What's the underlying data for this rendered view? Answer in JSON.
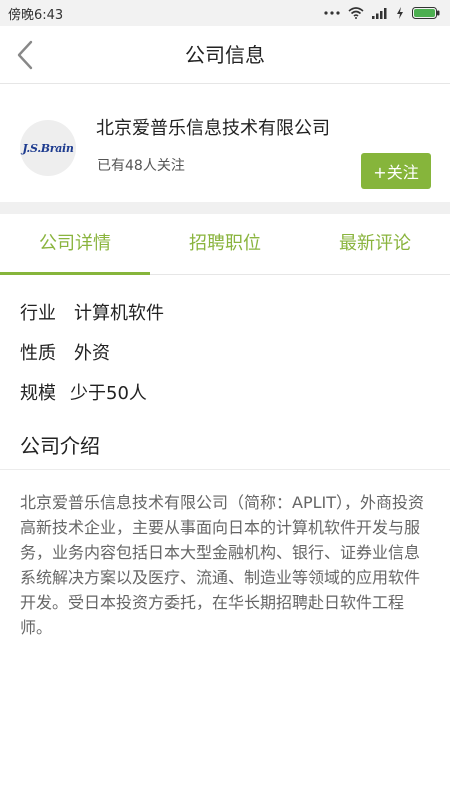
{
  "status_bar": {
    "time": "傍晚6:43"
  },
  "nav": {
    "title": "公司信息",
    "back_icon": "chevron-left-icon"
  },
  "company": {
    "logo_text": "J.S.Brain",
    "name": "北京爱普乐信息技术有限公司",
    "followers_text": "已有48人关注",
    "follow_label": "+关注"
  },
  "tabs": [
    {
      "label": "公司详情",
      "active": true
    },
    {
      "label": "招聘职位",
      "active": false
    },
    {
      "label": "最新评论",
      "active": false
    }
  ],
  "details": [
    {
      "label": "行业",
      "value": "计算机软件"
    },
    {
      "label": "性质",
      "value": "外资"
    },
    {
      "label": "规模",
      "value": "少于50人"
    }
  ],
  "intro": {
    "title": "公司介绍",
    "text": "北京爱普乐信息技术有限公司（简称：APLIT），外商投资高新技术企业，主要从事面向日本的计算机软件开发与服务，业务内容包括日本大型金融机构、银行、证券业信息系统解决方案以及医疗、流通、制造业等领域的应用软件开发。受日本投资方委托，在华长期招聘赴日软件工程师。"
  },
  "colors": {
    "accent": "#86b53b",
    "tab_text": "#8ab43e"
  }
}
